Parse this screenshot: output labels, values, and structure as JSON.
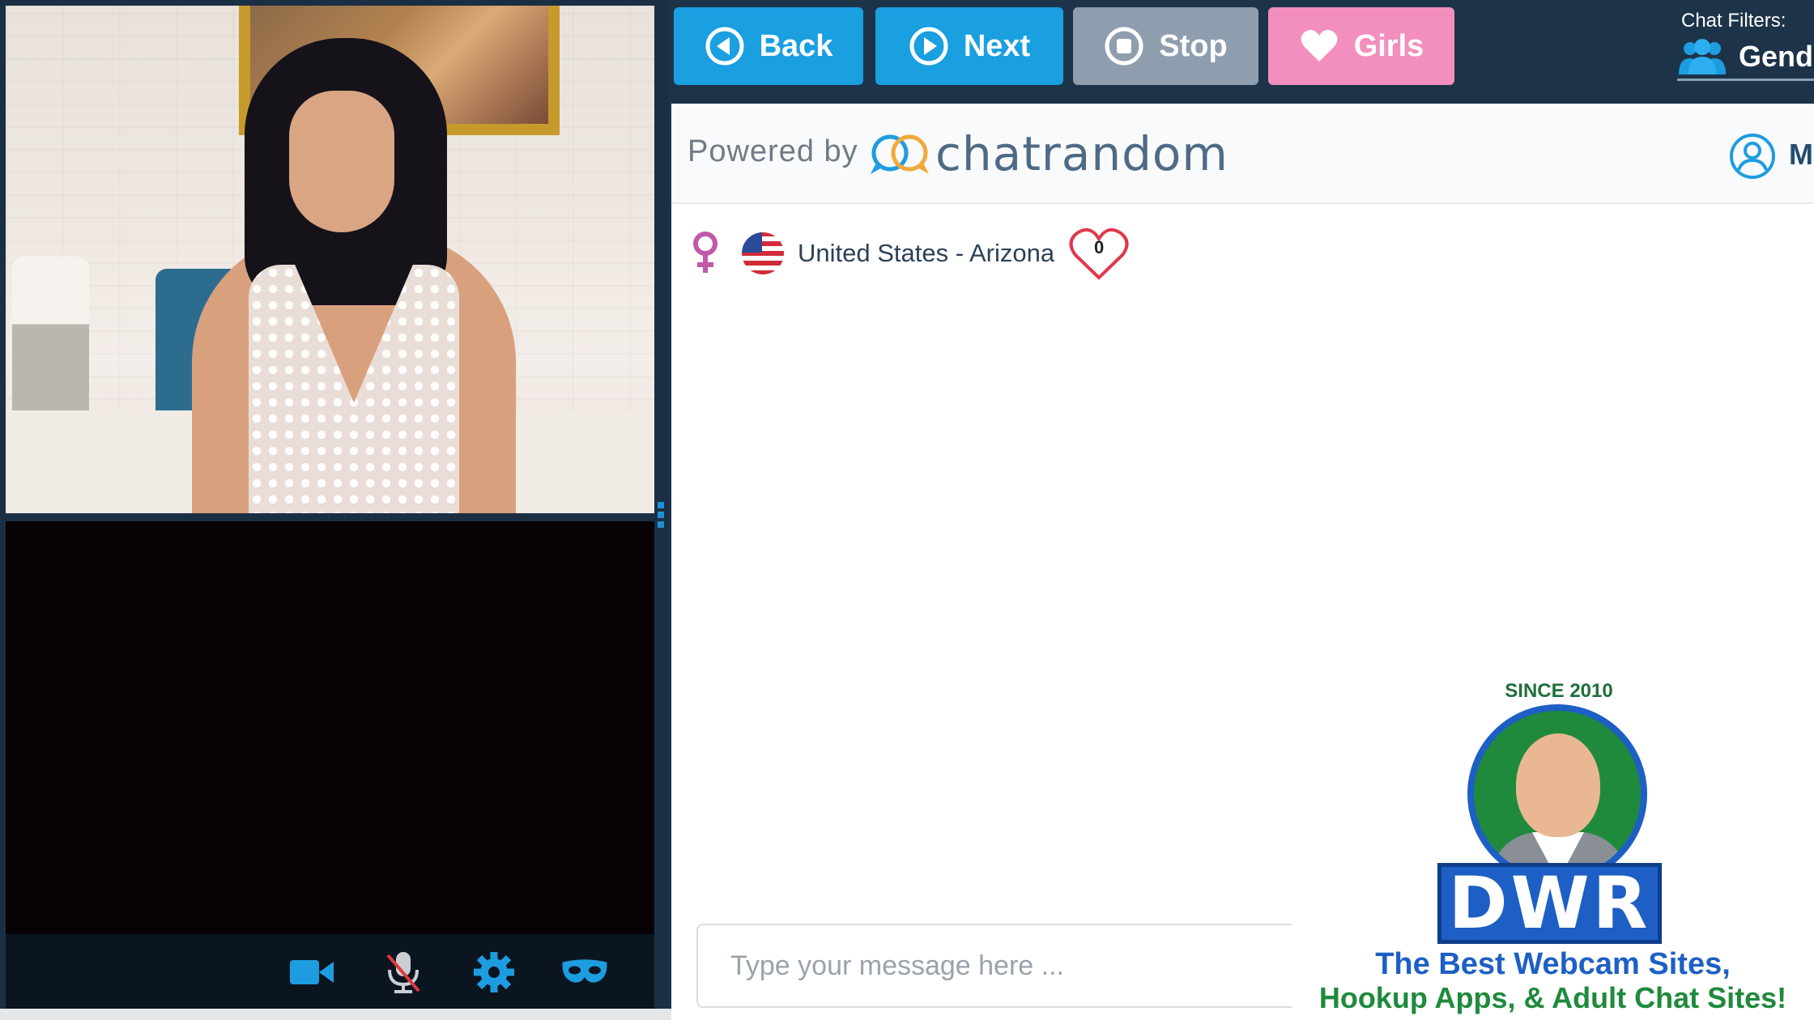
{
  "toolbar": {
    "back_label": "Back",
    "next_label": "Next",
    "stop_label": "Stop",
    "girls_label": "Girls"
  },
  "filters": {
    "title": "Chat Filters:",
    "gender_label": "Gend"
  },
  "chat": {
    "powered_by": "Powered by",
    "brand_name": "chatrandom",
    "profile_label": "M",
    "partner": {
      "gender_icon": "female-icon",
      "flag_icon": "us-flag-icon",
      "location": "United States - Arizona",
      "likes": "0"
    },
    "input_placeholder": "Type your message here ..."
  },
  "controls": {
    "icons": [
      "video-camera-icon",
      "microphone-muted-icon",
      "settings-gear-icon",
      "mask-icon"
    ]
  },
  "watermark": {
    "since": "SINCE 2010",
    "name": "DWR",
    "tagline_1": "The Best Webcam Sites,",
    "tagline_2": "Hookup Apps, & Adult Chat Sites!"
  },
  "colors": {
    "primary_blue": "#1a9fe0",
    "stop_gray": "#8e9eae",
    "girls_pink": "#f28fbe",
    "header_navy": "#1d3349"
  }
}
